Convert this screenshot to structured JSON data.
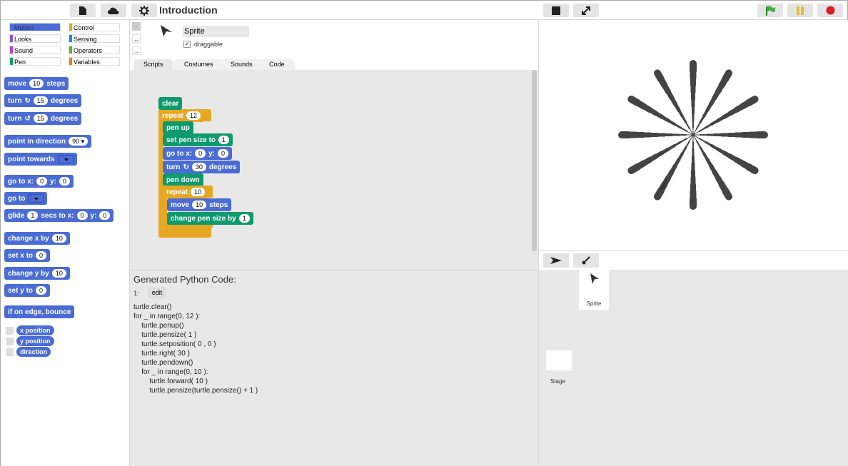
{
  "app": {
    "title": "Introduction"
  },
  "colors": {
    "motion": "#4a6cd4",
    "looks": "#8a55d7",
    "sound": "#bb42c3",
    "pen": "#0e9a6c",
    "control": "#e6a822",
    "sensing": "#0494dc",
    "operators": "#5cb712",
    "variables": "#ee7d16",
    "flag": "#44b044",
    "pause": "#e6c022",
    "stop": "#d22222"
  },
  "toolbar": {
    "file_icon": "file-icon",
    "cloud_icon": "cloud-icon",
    "settings_icon": "gear-icon"
  },
  "categories": [
    "Motion",
    "Looks",
    "Sound",
    "Pen",
    "Control",
    "Sensing",
    "Operators",
    "Variables"
  ],
  "palette": {
    "move": {
      "label1": "move",
      "val": "10",
      "label2": "steps"
    },
    "turn_cw": {
      "label1": "turn",
      "val": "15",
      "label2": "degrees"
    },
    "turn_ccw": {
      "label1": "turn",
      "val": "15",
      "label2": "degrees"
    },
    "point_dir": {
      "label": "point in direction",
      "val": "90"
    },
    "point_towards": {
      "label": "point towards"
    },
    "goto_xy": {
      "label1": "go to x:",
      "x": "0",
      "label2": "y:",
      "y": "0"
    },
    "goto": {
      "label": "go to"
    },
    "glide": {
      "label1": "glide",
      "secs": "1",
      "label2": "secs to x:",
      "x": "0",
      "label3": "y:",
      "y": "0"
    },
    "change_x": {
      "label": "change x by",
      "val": "10"
    },
    "set_x": {
      "label": "set x to",
      "val": "0"
    },
    "change_y": {
      "label": "change y by",
      "val": "10"
    },
    "set_y": {
      "label": "set y to",
      "val": "0"
    },
    "bounce": {
      "label": "if on edge, bounce"
    },
    "reporters": [
      "x position",
      "y position",
      "direction"
    ]
  },
  "sprite": {
    "name": "Sprite",
    "draggable_label": "draggable"
  },
  "tabs": [
    "Scripts",
    "Costumes",
    "Sounds",
    "Code"
  ],
  "script": {
    "clear": "clear",
    "repeat1": {
      "label": "repeat",
      "val": "12"
    },
    "penup": "pen up",
    "pensize": {
      "label": "set pen size to",
      "val": "1"
    },
    "goto": {
      "label1": "go to x:",
      "x": "0",
      "label2": "y:",
      "y": "0"
    },
    "turn": {
      "label1": "turn",
      "val": "30",
      "label2": "degrees"
    },
    "pendown": "pen down",
    "repeat2": {
      "label": "repeat",
      "val": "10"
    },
    "move": {
      "label1": "move",
      "val": "10",
      "label2": "steps"
    },
    "changepen": {
      "label": "change pen size by",
      "val": "1"
    }
  },
  "code": {
    "heading": "Generated Python Code:",
    "line_no": "1:",
    "edit": "edit",
    "lines": [
      "turtle.clear()",
      "for _ in range(0, 12 ):",
      "    turtle.penup()",
      "    turtle.pensize( 1 )",
      "    turtle.setposition( 0 , 0 )",
      "    turtle.right( 30 )",
      "    turtle.pendown()",
      "    for _ in range(0, 10 ):",
      "        turtle.forward( 10 )",
      "        turtle.pensize(turtle.pensize() + 1 )"
    ]
  },
  "corral": {
    "sprite_label": "Sprite",
    "stage_label": "Stage"
  }
}
